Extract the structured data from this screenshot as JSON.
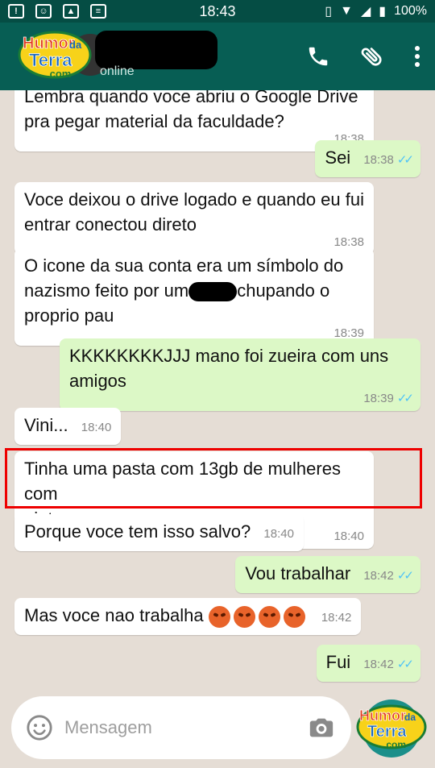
{
  "status_bar": {
    "time": "18:43",
    "battery": "100%"
  },
  "header": {
    "status": "online"
  },
  "branding": {
    "logo_top": "Humor",
    "logo_mid": "da",
    "logo_main": "Terra",
    "logo_dot": ".com"
  },
  "messages": [
    {
      "dir": "in",
      "lines": [
        "Lembra quando voce abriu o Google Drive",
        "pra pegar material da faculdade?"
      ],
      "time": "18:38"
    },
    {
      "dir": "out",
      "text": "Sei",
      "time": "18:38"
    },
    {
      "dir": "in",
      "lines": [
        "Voce deixou o drive logado e quando eu fui",
        "entrar conectou direto"
      ],
      "time": "18:38"
    },
    {
      "dir": "in",
      "line1": "O icone da sua conta era um símbolo do",
      "line2_a": "nazismo feito por um",
      "line2_b": "chupando o",
      "line3": "proprio pau",
      "time": "18:39"
    },
    {
      "dir": "out",
      "lines": [
        "KKKKKKKKJJJ mano foi zueira com uns",
        "amigos"
      ],
      "time": "18:39"
    },
    {
      "dir": "in",
      "text": "Vini...",
      "time": "18:40"
    },
    {
      "dir": "in",
      "lines": [
        "Tinha uma pasta com 13gb de mulheres com",
        "pinto..."
      ],
      "time": "18:40"
    },
    {
      "dir": "in",
      "text": "Porque voce tem isso salvo?",
      "time": "18:40"
    },
    {
      "dir": "out",
      "text": "Vou trabalhar",
      "time": "18:42"
    },
    {
      "dir": "in",
      "text": "Mas voce nao trabalha",
      "time": "18:42"
    },
    {
      "dir": "out",
      "text": "Fui",
      "time": "18:42"
    }
  ],
  "composer": {
    "placeholder": "Mensagem"
  },
  "colors": {
    "header": "#075e54",
    "status_bar": "#054d44",
    "outgoing": "#dcf8c6",
    "incoming": "#ffffff",
    "highlight": "#e00000",
    "read_ticks": "#4fc3f7"
  }
}
